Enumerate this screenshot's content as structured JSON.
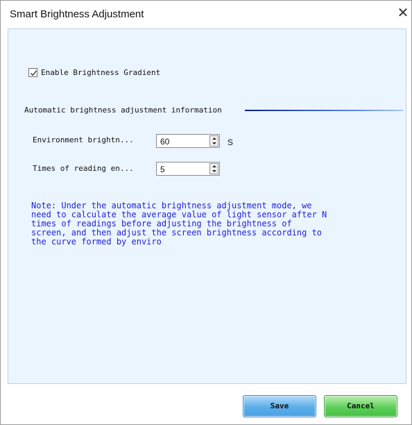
{
  "window": {
    "title": "Smart Brightness Adjustment",
    "close_glyph": "✕"
  },
  "options": {
    "enable_gradient_label": "Enable Brightness Gradient",
    "enable_gradient_checked": true
  },
  "group": {
    "title": "Automatic brightness adjustment information"
  },
  "fields": {
    "environment": {
      "label": "Environment brightn...",
      "value": "60",
      "unit": "S"
    },
    "times": {
      "label": "Times of reading en...",
      "value": "5"
    }
  },
  "note": "Note: Under the automatic brightness adjustment mode, we\nneed to calculate the average value of light sensor after N\ntimes of readings before adjusting the brightness of\nscreen, and then adjust the screen brightness according to\nthe curve formed by enviro",
  "buttons": {
    "save": "Save",
    "cancel": "Cancel"
  },
  "colors": {
    "note_text": "#1f1fd6",
    "panel_bg": "#ebf5ff",
    "save_button": "#5aaee9",
    "cancel_button": "#5ed05a"
  }
}
